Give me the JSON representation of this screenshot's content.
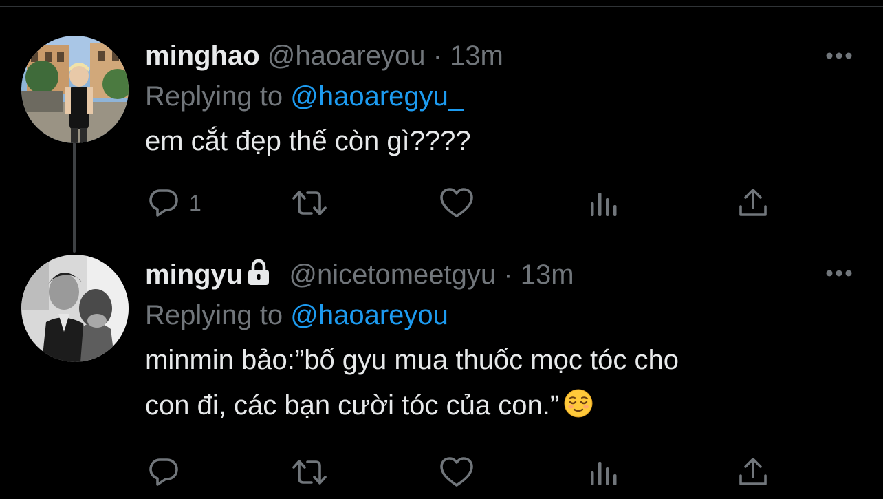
{
  "colors": {
    "background": "#000000",
    "text_primary": "#e7e9ea",
    "text_secondary": "#71767b",
    "accent": "#1d9bf0"
  },
  "tweets": [
    {
      "display_name": "minghao",
      "handle": "@haoareyou",
      "separator": "·",
      "time": "13m",
      "replying_prefix": "Replying to",
      "replying_to": "@haoaregyu_",
      "body_lines": [
        "em cắt đẹp thế còn gì????"
      ],
      "reply_count": "1",
      "icons": [
        "more-icon",
        "reply-icon",
        "retweet-icon",
        "like-icon",
        "views-icon",
        "share-icon"
      ]
    },
    {
      "display_name": "mingyu",
      "protected": true,
      "handle": "@nicetomeetgyu",
      "separator": "·",
      "time": "13m",
      "replying_prefix": "Replying to",
      "replying_to": "@haoareyou",
      "body_lines": [
        "minmin bảo:”bố gyu mua thuốc mọc tóc cho",
        "con đi, các bạn cười tóc của con.”"
      ],
      "emoji": "relieved-face",
      "reply_count": "",
      "icons": [
        "lock-icon",
        "more-icon",
        "reply-icon",
        "retweet-icon",
        "like-icon",
        "views-icon",
        "share-icon"
      ]
    }
  ]
}
